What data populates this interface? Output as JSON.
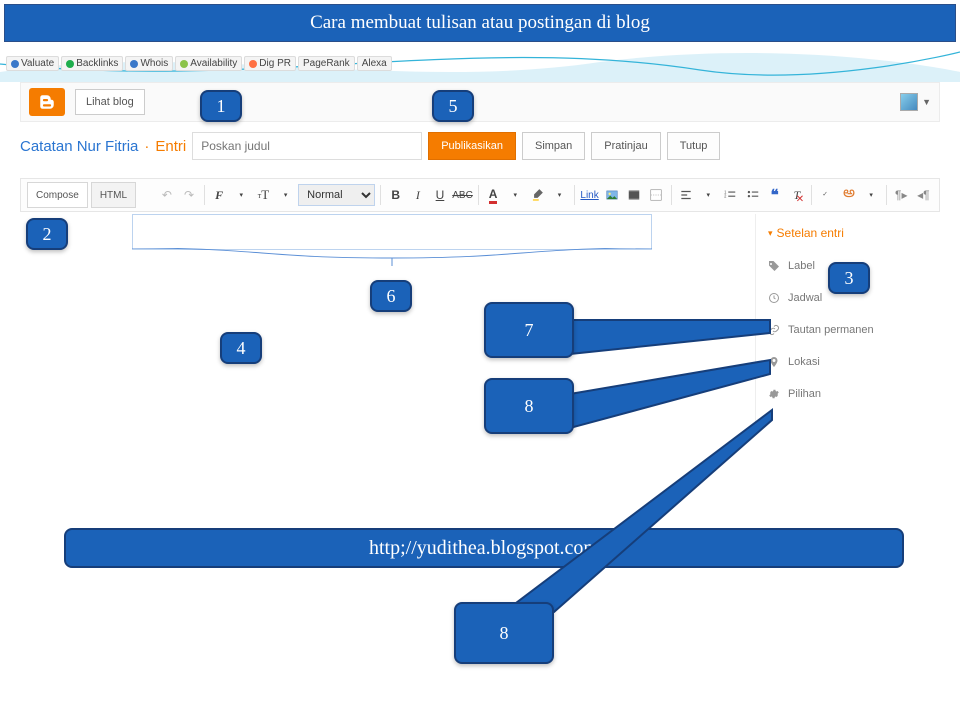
{
  "banner_title": "Cara membuat tulisan atau postingan di blog",
  "seo_toolbar": {
    "valuate": "Valuate",
    "backlinks": "Backlinks",
    "whois": "Whois",
    "availability": "Availability",
    "digpr": "Dig PR",
    "pagerank": "PageRank",
    "alexa": "Alexa"
  },
  "header": {
    "lihat_blog": "Lihat blog"
  },
  "post": {
    "blog_name": "Catatan Nur Fitria",
    "entri_label": "Entri",
    "title_placeholder": "Poskan judul",
    "publish": "Publikasikan",
    "save": "Simpan",
    "preview": "Pratinjau",
    "close": "Tutup"
  },
  "editor_tabs": {
    "compose": "Compose",
    "html": "HTML"
  },
  "font_select": "Normal",
  "link_label": "Link",
  "right_panel": {
    "header": "Setelan entri",
    "label": "Label",
    "jadwal": "Jadwal",
    "tautan": "Tautan permanen",
    "lokasi": "Lokasi",
    "pilihan": "Pilihan"
  },
  "callouts": {
    "c1": "1",
    "c2": "2",
    "c3": "3",
    "c4": "4",
    "c5": "5",
    "c6": "6",
    "c7": "7",
    "c8a": "8",
    "c8b": "8"
  },
  "footer_url": "http;//yudithea.blogspot.com"
}
